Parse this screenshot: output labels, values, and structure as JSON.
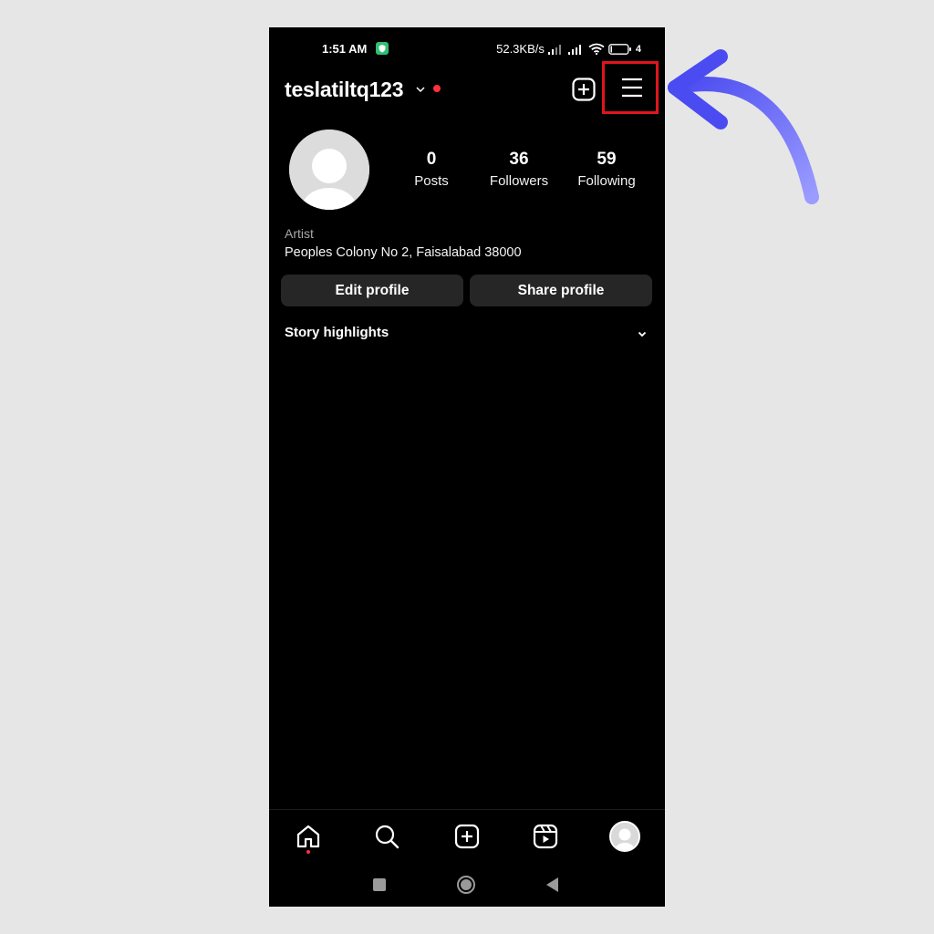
{
  "status_bar": {
    "time": "1:51 AM",
    "net_speed": "52.3KB/s",
    "battery": "4"
  },
  "profile": {
    "username": "teslatiltq123",
    "stats": [
      {
        "value": "0",
        "label": "Posts"
      },
      {
        "value": "36",
        "label": "Followers"
      },
      {
        "value": "59",
        "label": "Following"
      }
    ],
    "bio_category": "Artist",
    "bio_address": "Peoples Colony No 2, Faisalabad 38000"
  },
  "buttons": {
    "edit_profile": "Edit profile",
    "share_profile": "Share profile"
  },
  "highlights": {
    "title": "Story highlights"
  },
  "icons": {
    "create": "plus-square-icon",
    "menu": "hamburger-menu-icon",
    "nav": [
      "home-icon",
      "search-icon",
      "create-icon",
      "reels-icon",
      "profile-avatar"
    ],
    "system": [
      "recent-apps-icon",
      "home-circle-icon",
      "back-triangle-icon"
    ]
  },
  "colors": {
    "background": "#000000",
    "button_bg": "#262626",
    "notification": "#ff3040",
    "highlight_box": "#e1141c",
    "annotation_arrow": "#6b6bf5",
    "page_bg": "#e6e6e6"
  }
}
